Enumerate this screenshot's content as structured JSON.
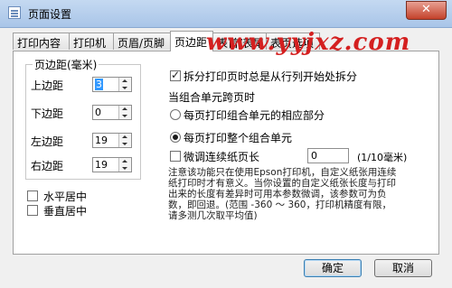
{
  "window": {
    "title": "页面设置",
    "close_label": "✕"
  },
  "tabs": [
    {
      "label": "打印内容"
    },
    {
      "label": "打印机"
    },
    {
      "label": "页眉/页脚"
    },
    {
      "label": "页边距"
    },
    {
      "label": "表首/表尾"
    },
    {
      "label": "表页选项"
    }
  ],
  "margins": {
    "group_title": "页边距(毫米)",
    "top_label": "上边距",
    "top_value": "3",
    "bottom_label": "下边距",
    "bottom_value": "0",
    "left_label": "左边距",
    "left_value": "19",
    "right_label": "右边距",
    "right_value": "19"
  },
  "center": {
    "horizontal_label": "水平居中",
    "horizontal_checked": false,
    "vertical_label": "垂直居中",
    "vertical_checked": false
  },
  "options": {
    "split_by_row_label": "拆分打印页时总是从行列开始处拆分",
    "split_by_row_checked": true,
    "group_header": "当组合单元跨页时",
    "radio_part_label": "每页打印组合单元的相应部分",
    "radio_whole_label": "每页打印整个组合单元",
    "selected_radio": "whole",
    "adjust_paper_label": "微调连续纸页长",
    "adjust_paper_checked": false,
    "adjust_value": "0",
    "adjust_unit": "(1/10毫米)",
    "note_lines": [
      "注意该功能只在使用Epson打印机，自定义纸张用连续",
      "纸打印时才有意义。当你设置的自定义纸张长度与打印",
      "出来的长度有差异时可用本参数微调，该参数可为负",
      "数，即回退。(范围 -360 ～ 360，打印机精度有限，",
      "请多测几次取平均值)"
    ]
  },
  "buttons": {
    "ok": "确定",
    "cancel": "取消"
  },
  "watermark": "www.yyjxz.com"
}
